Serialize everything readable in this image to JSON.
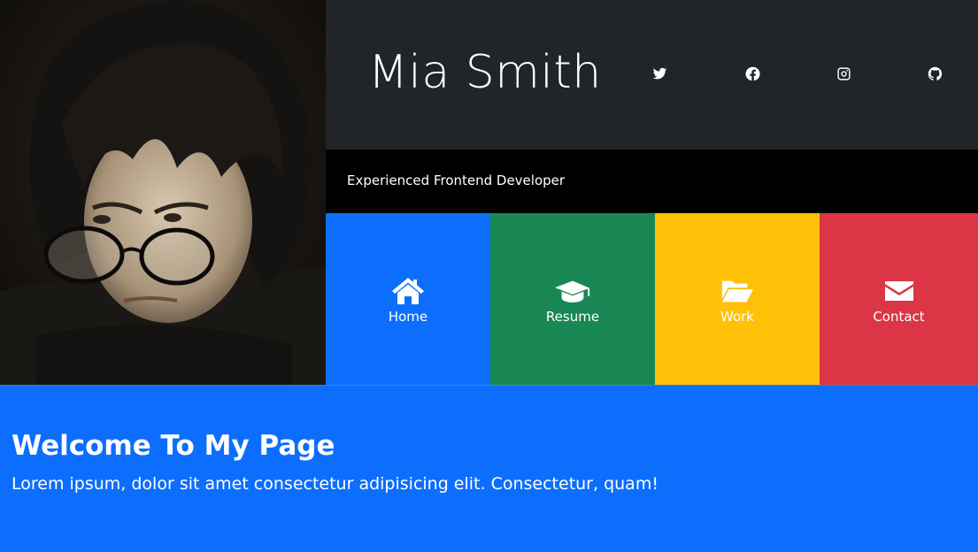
{
  "header": {
    "name": "Mia Smith",
    "social": [
      {
        "icon": "twitter-icon"
      },
      {
        "icon": "facebook-icon"
      },
      {
        "icon": "instagram-icon"
      },
      {
        "icon": "github-icon"
      }
    ]
  },
  "tagline": "Experienced Frontend Developer",
  "nav": {
    "home": {
      "label": "Home",
      "icon": "home-icon",
      "color": "#0d6efd"
    },
    "resume": {
      "label": "Resume",
      "icon": "graduation-cap-icon",
      "color": "#198754"
    },
    "work": {
      "label": "Work",
      "icon": "folder-open-icon",
      "color": "#ffc107"
    },
    "contact": {
      "label": "Contact",
      "icon": "envelope-icon",
      "color": "#dc3545"
    }
  },
  "main": {
    "heading": "Welcome To My Page",
    "body": "Lorem ipsum, dolor sit amet consectetur adipisicing elit. Consectetur, quam!"
  },
  "colors": {
    "header_bg": "#212529",
    "tagline_bg": "#000000",
    "page_bg": "#0d6efd"
  }
}
